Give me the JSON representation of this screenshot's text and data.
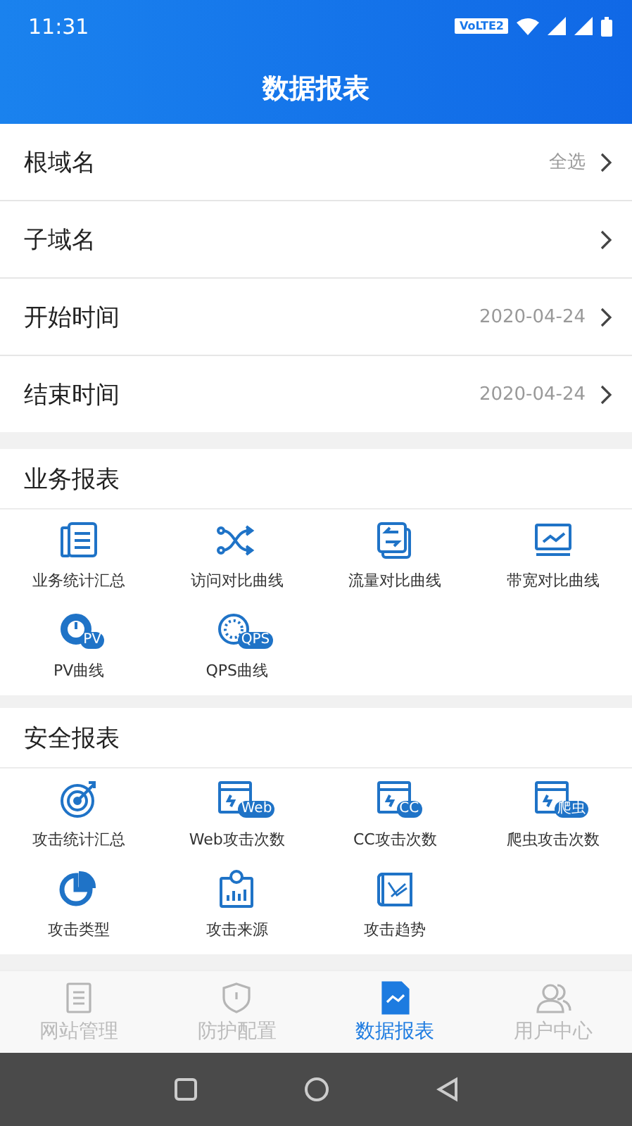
{
  "status_bar": {
    "time": "11:31",
    "network_badge": "VoLTE2"
  },
  "header": {
    "title": "数据报表"
  },
  "filters": [
    {
      "label": "根域名",
      "value": "全选"
    },
    {
      "label": "子域名"
    },
    {
      "label": "开始时间",
      "value": "2020-04-24"
    },
    {
      "label": "结束时间",
      "value": "2020-04-24"
    }
  ],
  "sections": [
    {
      "title": "业务报表",
      "items": [
        {
          "label": "业务统计汇总",
          "kind": "document"
        },
        {
          "label": "访问对比曲线",
          "kind": "shuffle"
        },
        {
          "label": "流量对比曲线",
          "kind": "transfer"
        },
        {
          "label": "带宽对比曲线",
          "kind": "monitor"
        },
        {
          "label": "PV曲线",
          "kind": "gauge",
          "badge": "PV"
        },
        {
          "label": "QPS曲线",
          "kind": "dial",
          "badge": "QPS"
        }
      ]
    },
    {
      "title": "安全报表",
      "items": [
        {
          "label": "攻击统计汇总",
          "kind": "target"
        },
        {
          "label": "Web攻击次数",
          "kind": "window",
          "badge": "Web"
        },
        {
          "label": "CC攻击次数",
          "kind": "window",
          "badge": "CC"
        },
        {
          "label": "爬虫攻击次数",
          "kind": "window",
          "badge": "爬虫"
        },
        {
          "label": "攻击类型",
          "kind": "pie"
        },
        {
          "label": "攻击来源",
          "kind": "barchart"
        },
        {
          "label": "攻击趋势",
          "kind": "scroll"
        }
      ]
    }
  ],
  "tab_bar": [
    {
      "label": "网站管理",
      "kind": "list",
      "selected": false
    },
    {
      "label": "防护配置",
      "kind": "shield",
      "selected": false
    },
    {
      "label": "数据报表",
      "kind": "report",
      "selected": true
    },
    {
      "label": "用户中心",
      "kind": "users",
      "selected": false
    }
  ]
}
